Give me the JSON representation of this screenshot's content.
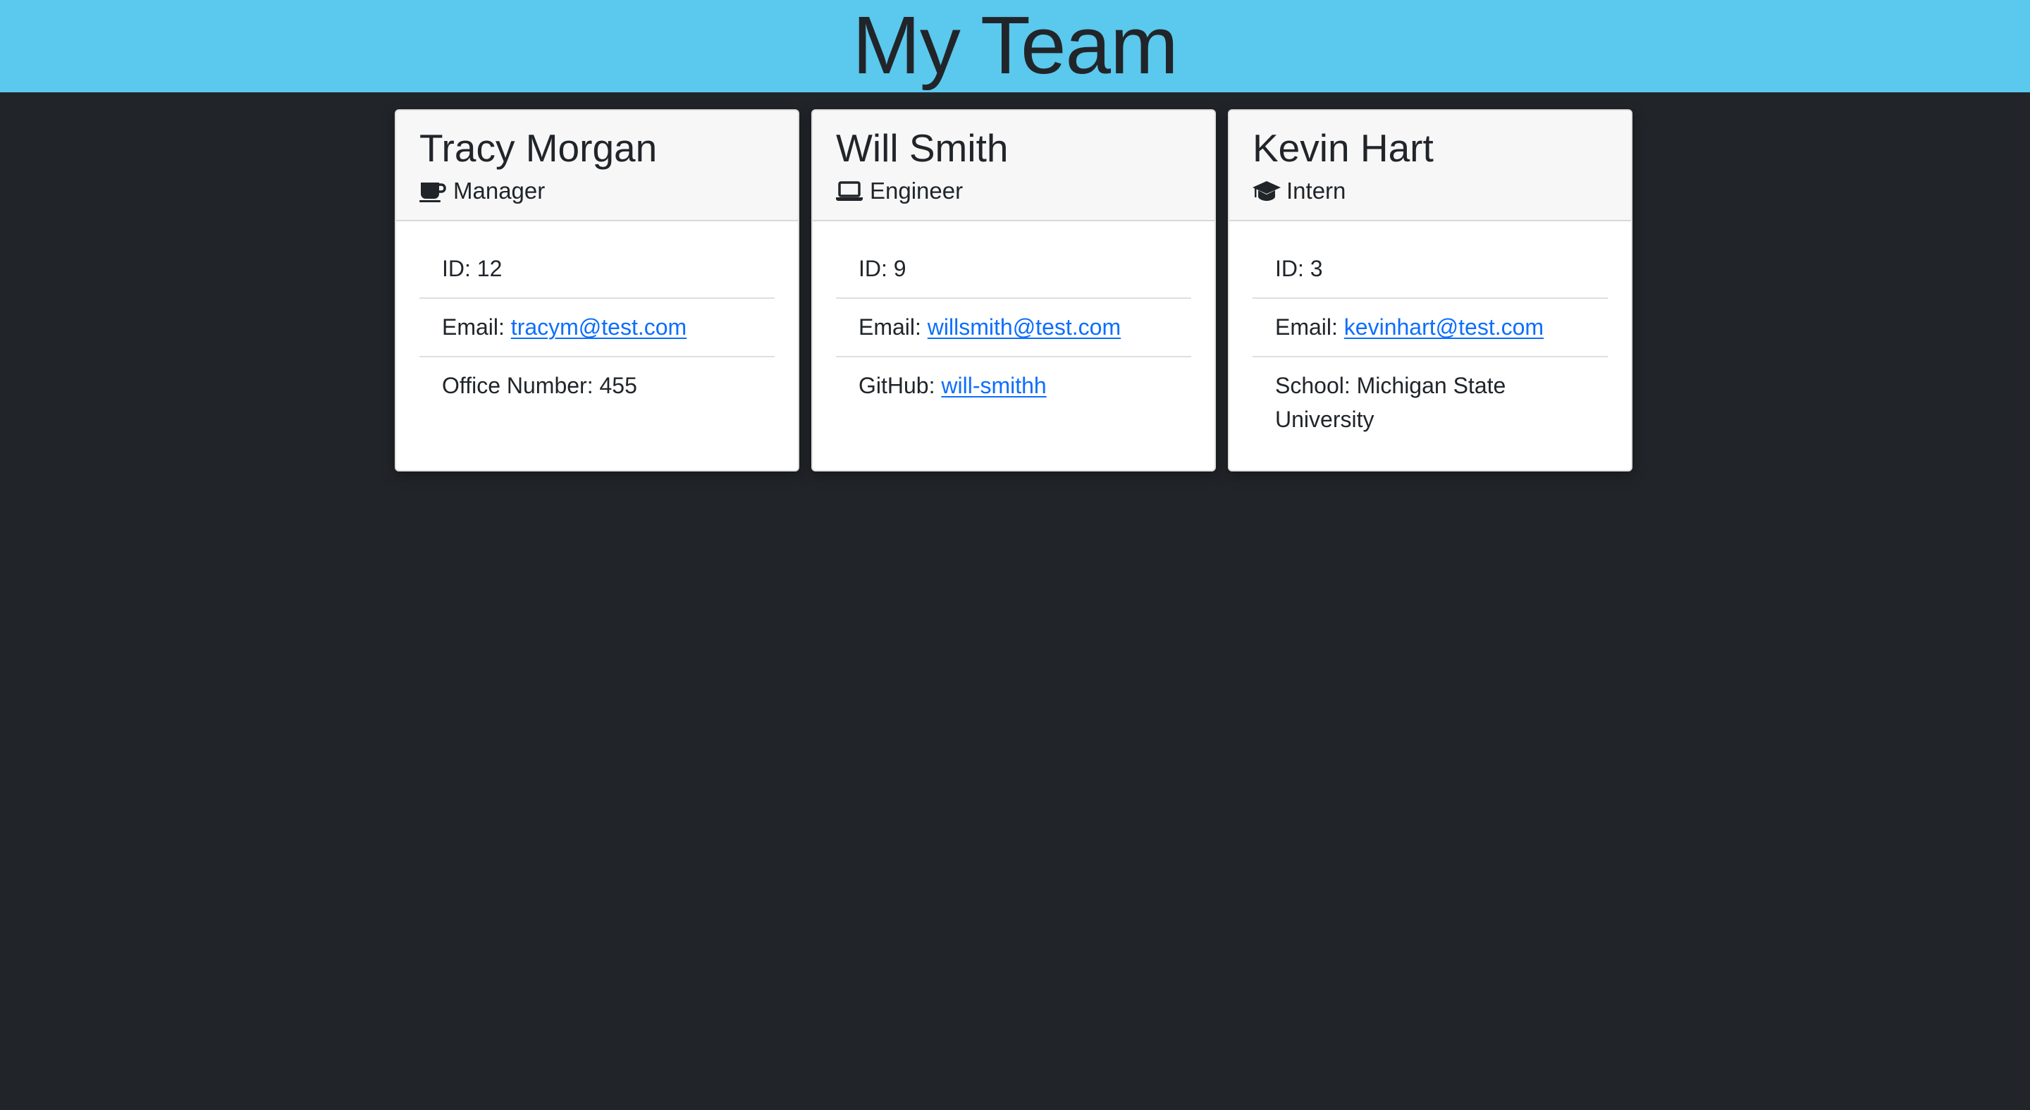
{
  "header": {
    "title": "My Team",
    "background_color": "#5bc8ed"
  },
  "page": {
    "background_color": "#212529",
    "link_color": "#0d6efd"
  },
  "employees": [
    {
      "name": "Tracy Morgan",
      "role": "Manager",
      "role_icon": "mug-hot-icon",
      "id_label": "ID: ",
      "id": "12",
      "email_label": "Email: ",
      "email": "tracym@test.com",
      "extra_label": "Office Number: ",
      "extra_value": "455"
    },
    {
      "name": "Will Smith",
      "role": "Engineer",
      "role_icon": "laptop-icon",
      "id_label": "ID: ",
      "id": "9",
      "email_label": "Email: ",
      "email": "willsmith@test.com",
      "extra_label": "GitHub: ",
      "extra_value": "will-smithh"
    },
    {
      "name": "Kevin Hart",
      "role": "Intern",
      "role_icon": "graduation-cap-icon",
      "id_label": "ID: ",
      "id": "3",
      "email_label": "Email: ",
      "email": "kevinhart@test.com",
      "extra_label": "School: ",
      "extra_value": "Michigan State University"
    }
  ]
}
